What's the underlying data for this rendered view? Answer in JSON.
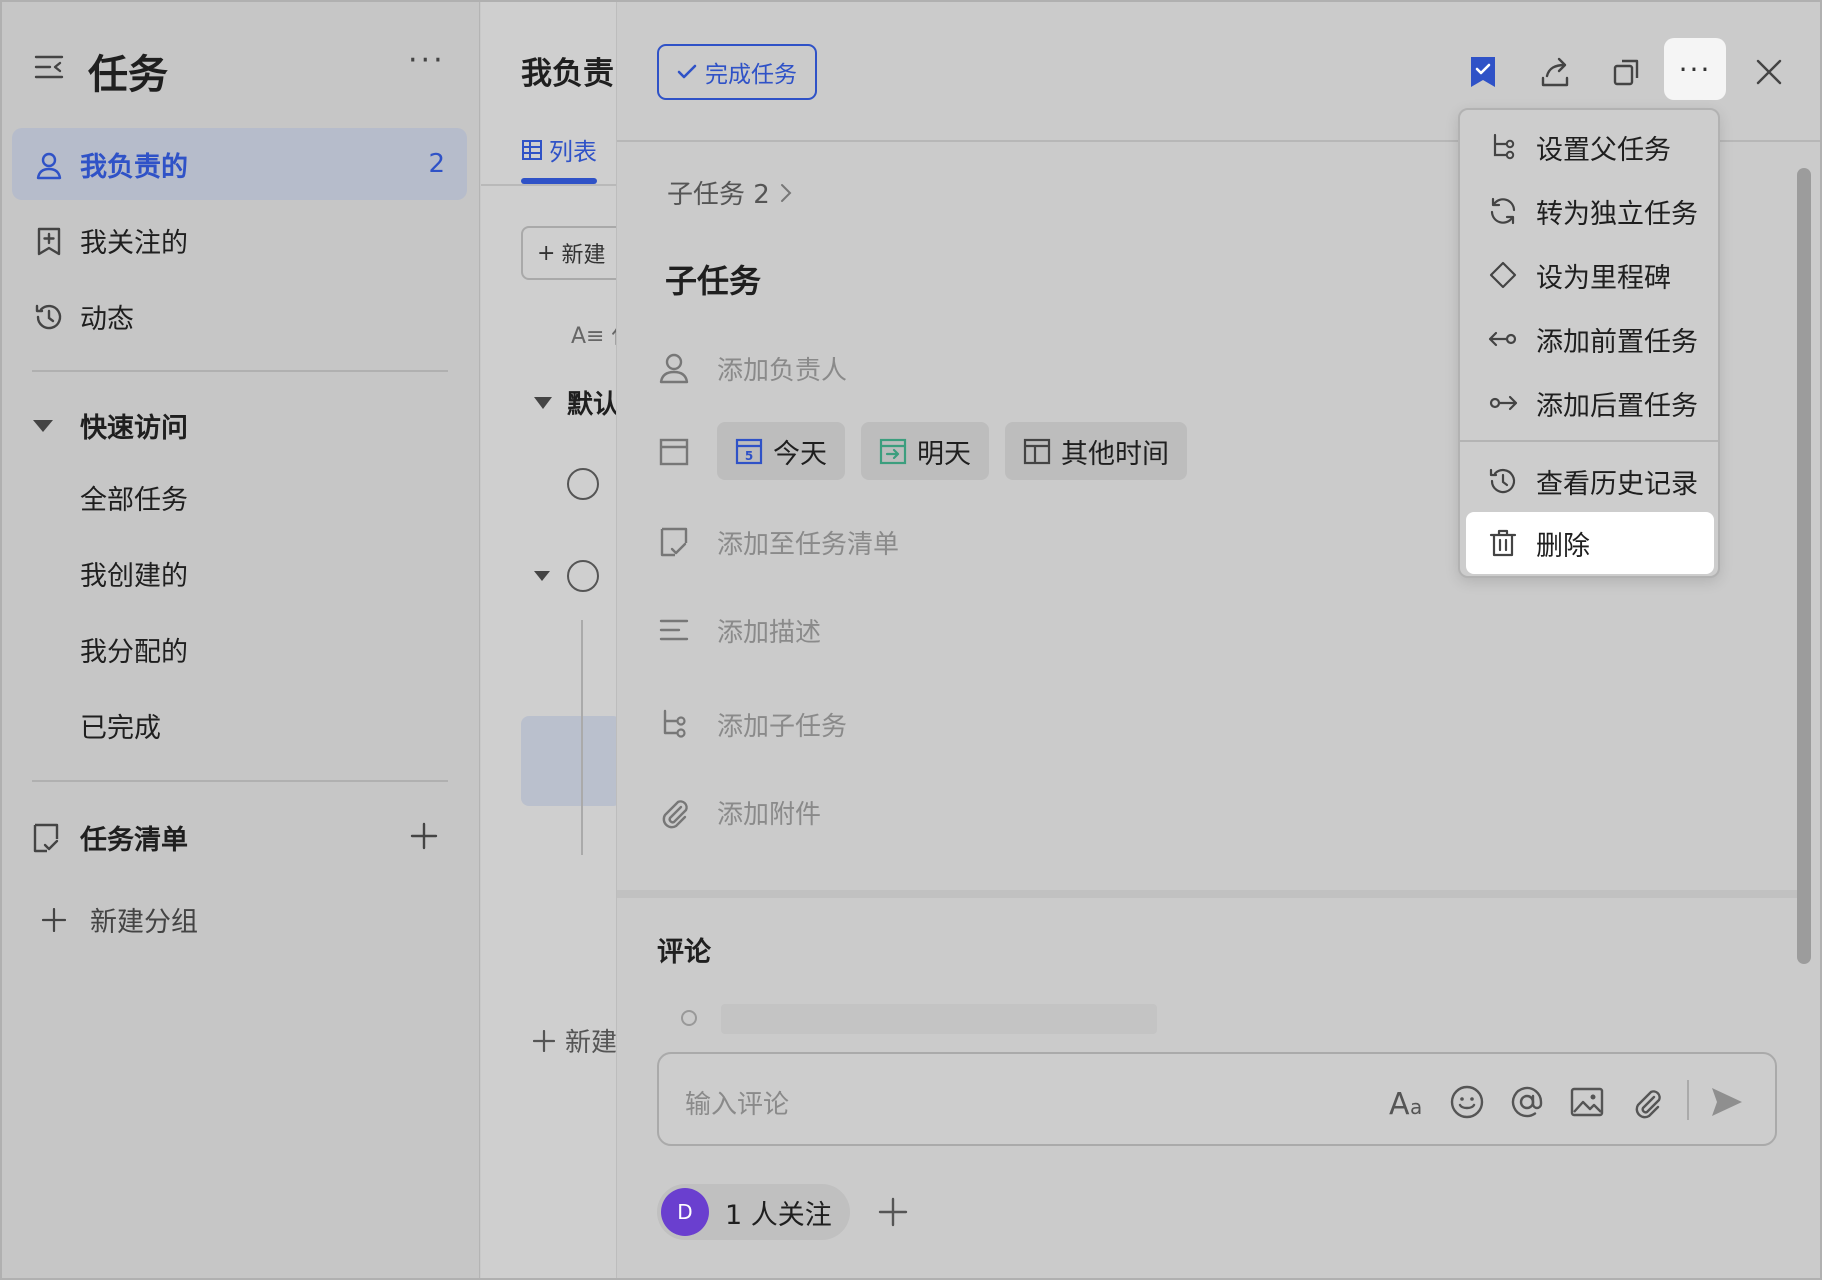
{
  "sidebar": {
    "title": "任务",
    "items": [
      {
        "label": "我负责的",
        "count": "2"
      },
      {
        "label": "我关注的"
      },
      {
        "label": "动态"
      }
    ],
    "quick_access": {
      "title": "快速访问",
      "items": [
        "全部任务",
        "我创建的",
        "我分配的",
        "已完成"
      ]
    },
    "task_lists": {
      "title": "任务清单"
    },
    "new_group": "新建分组"
  },
  "list": {
    "title": "我负责",
    "tab": "列表",
    "new_button": "新建",
    "column": "A≡ 任",
    "group": "默认",
    "add_new": "新建"
  },
  "detail": {
    "complete_button": "完成任务",
    "breadcrumb": "子任务 2",
    "title": "子任务",
    "assignee_placeholder": "添加负责人",
    "date_chips": [
      "今天",
      "明天",
      "其他时间"
    ],
    "today_icon_num": "5",
    "add_to_list": "添加至任务清单",
    "add_description": "添加描述",
    "add_subtask": "添加子任务",
    "add_attachment": "添加附件",
    "comments_title": "评论",
    "comment_placeholder": "输入评论",
    "follower_avatar": "D",
    "followers": "1 人关注"
  },
  "menu": {
    "items": [
      "设置父任务",
      "转为独立任务",
      "设为里程碑",
      "添加前置任务",
      "添加后置任务",
      "查看历史记录",
      "删除"
    ]
  },
  "colors": {
    "accent": "#2f52c7",
    "avatar": "#6a3fcf",
    "tomorrow": "#3c9e7e"
  }
}
